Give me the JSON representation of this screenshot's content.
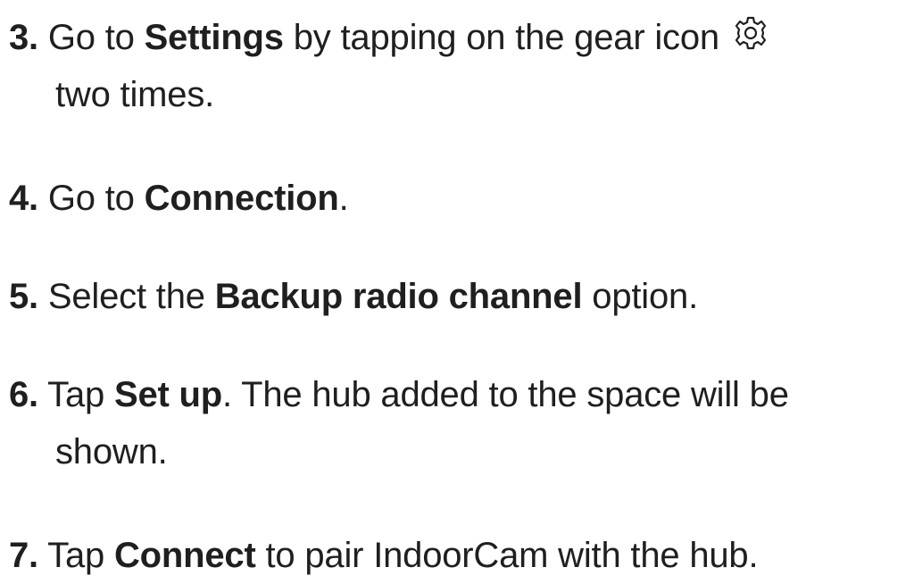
{
  "steps": [
    {
      "number": "3.",
      "before": "Go to ",
      "bold": "Settings",
      "after": " by tapping on the gear icon",
      "icon": "gear-icon",
      "continuation": "two times."
    },
    {
      "number": "4.",
      "before": "Go to ",
      "bold": "Connection",
      "after": "."
    },
    {
      "number": "5.",
      "before": "Select the ",
      "bold": "Backup radio channel",
      "after": " option."
    },
    {
      "number": "6.",
      "before": "Tap ",
      "bold": "Set up",
      "after": ". The hub added to the space will be",
      "continuation": "shown."
    },
    {
      "number": "7.",
      "before": "Tap ",
      "bold": "Connect",
      "after": " to pair IndoorCam with the hub."
    }
  ]
}
